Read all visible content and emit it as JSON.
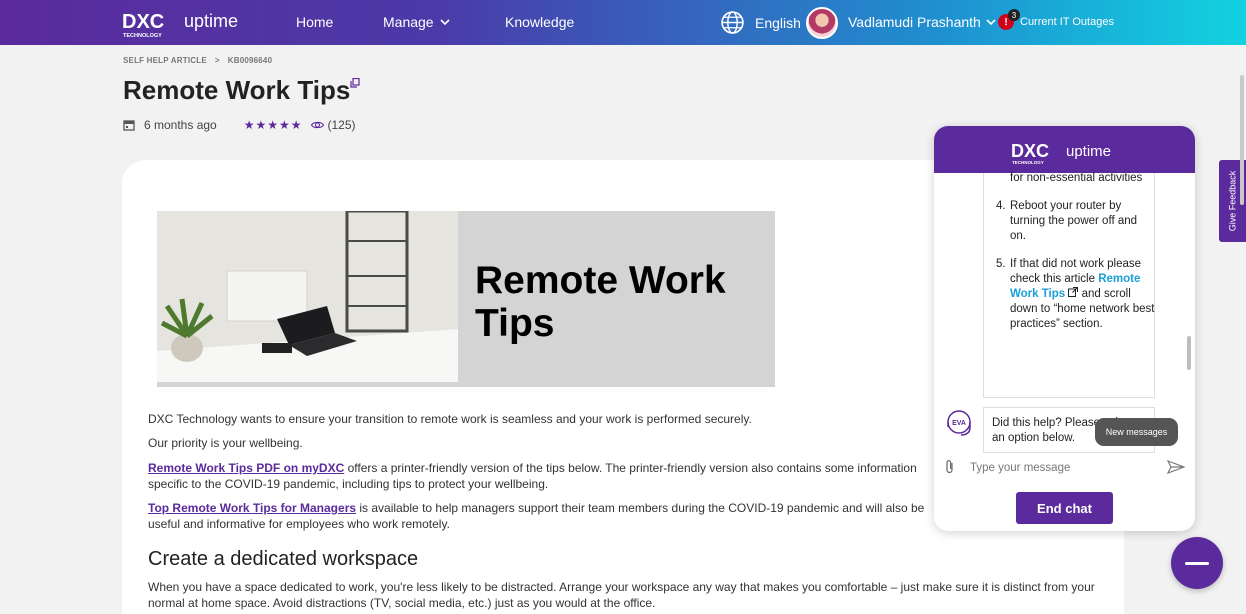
{
  "header": {
    "brand": "DXC",
    "brand_sub": "TECHNOLOGY",
    "product": "uptime",
    "nav": {
      "home": "Home",
      "manage": "Manage",
      "knowledge": "Knowledge"
    },
    "language": "English",
    "user_name": "Vadlamudi Prashanth",
    "alert_count": "3",
    "alert_symbol": "!",
    "outages": "Current IT Outages"
  },
  "breadcrumb": {
    "section": "SELF HELP ARTICLE",
    "separator": ">",
    "id": "KB0096640"
  },
  "article": {
    "title": "Remote Work Tips",
    "age": "6 months ago",
    "rating_stars": "★★★★★",
    "views": "(125)",
    "hero_title": "Remote Work Tips",
    "p1": "DXC Technology wants to ensure your transition to remote work is seamless and your work is performed securely.",
    "p2": "Our priority is your wellbeing.",
    "p3_link": "Remote Work Tips PDF on myDXC",
    "p3_text": " offers a printer-friendly version of the tips below. The printer-friendly version also contains some information specific to the COVID-19 pandemic, including tips to protect your wellbeing.",
    "p4_link": "Top Remote Work Tips for Managers",
    "p4_text": " is available to help managers support their team members during the COVID-19 pandemic and will also be useful and informative for employees who work remotely.",
    "h2": "Create a dedicated workspace",
    "p5": "When you have a space dedicated to work, you're less likely to be distracted. Arrange your workspace any way that makes you comfortable – just make sure it is distinct from your normal at home space. Avoid distractions (TV, social media, etc.) just as you would at the office."
  },
  "chat": {
    "list_tail": "for non-essential activities",
    "item4_num": "4.",
    "item4": "Reboot your router by turning the power off and on.",
    "item5_num": "5.",
    "item5_pre": "If that did not work please check this article ",
    "item5_link": "Remote Work Tips",
    "item5_post": " and scroll down to “home network best practices” section.",
    "question": "Did this help? Please select an option below.",
    "new_messages": "New messages",
    "input_placeholder": "Type your message",
    "end_chat": "End chat",
    "agent_label": "EVA"
  },
  "feedback": "Give Feedback",
  "colors": {
    "brand_purple": "#5b2a9c",
    "link_blue": "#1a9fd8",
    "gradient_end": "#12d2e0"
  }
}
